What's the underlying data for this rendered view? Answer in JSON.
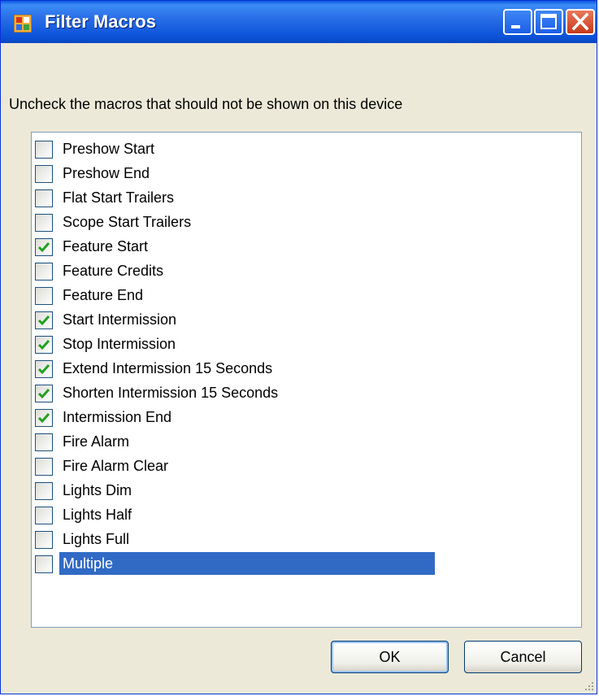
{
  "window": {
    "title": "Filter Macros",
    "colors": {
      "titlebar": "#0a58e0",
      "face": "#ece9d8",
      "selection": "#316ac5",
      "check": "#21a121"
    }
  },
  "instruction": "Uncheck the macros that should not be shown on this device",
  "macros": [
    {
      "label": "Preshow Start",
      "checked": false,
      "selected": false
    },
    {
      "label": "Preshow End",
      "checked": false,
      "selected": false
    },
    {
      "label": "Flat Start Trailers",
      "checked": false,
      "selected": false
    },
    {
      "label": "Scope Start Trailers",
      "checked": false,
      "selected": false
    },
    {
      "label": "Feature Start",
      "checked": true,
      "selected": false
    },
    {
      "label": "Feature Credits",
      "checked": false,
      "selected": false
    },
    {
      "label": "Feature End",
      "checked": false,
      "selected": false
    },
    {
      "label": "Start Intermission",
      "checked": true,
      "selected": false
    },
    {
      "label": "Stop Intermission",
      "checked": true,
      "selected": false
    },
    {
      "label": "Extend Intermission 15 Seconds",
      "checked": true,
      "selected": false
    },
    {
      "label": "Shorten Intermission 15 Seconds",
      "checked": true,
      "selected": false
    },
    {
      "label": "Intermission End",
      "checked": true,
      "selected": false
    },
    {
      "label": "Fire Alarm",
      "checked": false,
      "selected": false
    },
    {
      "label": "Fire Alarm Clear",
      "checked": false,
      "selected": false
    },
    {
      "label": "Lights Dim",
      "checked": false,
      "selected": false
    },
    {
      "label": "Lights Half",
      "checked": false,
      "selected": false
    },
    {
      "label": "Lights Full",
      "checked": false,
      "selected": false
    },
    {
      "label": "Multiple",
      "checked": false,
      "selected": true
    }
  ],
  "buttons": {
    "ok": "OK",
    "cancel": "Cancel"
  },
  "icons": {
    "app": "app-window-icon",
    "minimize": "minimize-icon",
    "maximize": "maximize-icon",
    "close": "close-icon",
    "check": "checkmark-icon",
    "grip": "resize-grip-icon"
  }
}
